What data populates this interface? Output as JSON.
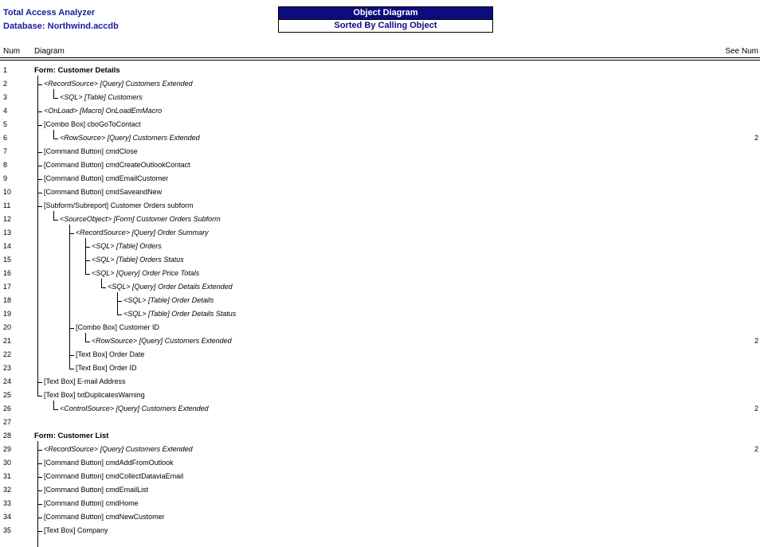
{
  "header": {
    "app_title": "Total Access Analyzer",
    "database": "Database: Northwind.accdb",
    "report_title": "Object Diagram",
    "report_subtitle": "Sorted By Calling Object"
  },
  "columns": {
    "num": "Num",
    "diagram": "Diagram",
    "see_num": "See Num"
  },
  "rows": [
    {
      "num": "1",
      "level": 0,
      "kind": "form",
      "prefix": "",
      "type": "",
      "name": "Form: Customer Details",
      "see": ""
    },
    {
      "num": "2",
      "level": 1,
      "kind": "ref",
      "prefix": "<RecordSource>",
      "type": "[Query]",
      "name": "Customers Extended",
      "see": ""
    },
    {
      "num": "3",
      "level": 2,
      "kind": "ref",
      "prefix": "<SQL>",
      "type": "[Table]",
      "name": "Customers",
      "see": "",
      "last": true
    },
    {
      "num": "4",
      "level": 1,
      "kind": "ref",
      "prefix": "<OnLoad>",
      "type": "[Macro]",
      "name": "OnLoadEmMacro",
      "see": ""
    },
    {
      "num": "5",
      "level": 1,
      "kind": "ctl",
      "prefix": "",
      "type": "[Combo Box]",
      "name": "cboGoToContact",
      "see": ""
    },
    {
      "num": "6",
      "level": 2,
      "kind": "ref",
      "prefix": "<RowSource>",
      "type": "[Query]",
      "name": "Customers Extended",
      "see": "2",
      "last": true
    },
    {
      "num": "7",
      "level": 1,
      "kind": "ctl",
      "prefix": "",
      "type": "[Command Button]",
      "name": "cmdClose",
      "see": ""
    },
    {
      "num": "8",
      "level": 1,
      "kind": "ctl",
      "prefix": "",
      "type": "[Command Button]",
      "name": "cmdCreateOutlookContact",
      "see": ""
    },
    {
      "num": "9",
      "level": 1,
      "kind": "ctl",
      "prefix": "",
      "type": "[Command Button]",
      "name": "cmdEmailCustomer",
      "see": ""
    },
    {
      "num": "10",
      "level": 1,
      "kind": "ctl",
      "prefix": "",
      "type": "[Command Button]",
      "name": "cmdSaveandNew",
      "see": ""
    },
    {
      "num": "11",
      "level": 1,
      "kind": "ctl",
      "prefix": "",
      "type": "[Subform/Subreport]",
      "name": "Customer Orders subform",
      "see": ""
    },
    {
      "num": "12",
      "level": 2,
      "kind": "ref",
      "prefix": "<SourceObject>",
      "type": "[Form]",
      "name": "Customer Orders Subform",
      "see": "",
      "last": true
    },
    {
      "num": "13",
      "level": 3,
      "kind": "ref",
      "prefix": "<RecordSource>",
      "type": "[Query]",
      "name": "Order Summary",
      "see": ""
    },
    {
      "num": "14",
      "level": 4,
      "kind": "ref",
      "prefix": "<SQL>",
      "type": "[Table]",
      "name": "Orders",
      "see": ""
    },
    {
      "num": "15",
      "level": 4,
      "kind": "ref",
      "prefix": "<SQL>",
      "type": "[Table]",
      "name": "Orders Status",
      "see": ""
    },
    {
      "num": "16",
      "level": 4,
      "kind": "ref",
      "prefix": "<SQL>",
      "type": "[Query]",
      "name": "Order Price Totals",
      "see": "",
      "last": true
    },
    {
      "num": "17",
      "level": 5,
      "kind": "ref",
      "prefix": "<SQL>",
      "type": "[Query]",
      "name": "Order Details Extended",
      "see": "",
      "last": true
    },
    {
      "num": "18",
      "level": 6,
      "kind": "ref",
      "prefix": "<SQL>",
      "type": "[Table]",
      "name": "Order Details",
      "see": ""
    },
    {
      "num": "19",
      "level": 6,
      "kind": "ref",
      "prefix": "<SQL>",
      "type": "[Table]",
      "name": "Order Details Status",
      "see": "",
      "last": true
    },
    {
      "num": "20",
      "level": 3,
      "kind": "ctl",
      "prefix": "",
      "type": "[Combo Box]",
      "name": "Customer ID",
      "see": ""
    },
    {
      "num": "21",
      "level": 4,
      "kind": "ref",
      "prefix": "<RowSource>",
      "type": "[Query]",
      "name": "Customers Extended",
      "see": "2",
      "last": true
    },
    {
      "num": "22",
      "level": 3,
      "kind": "ctl",
      "prefix": "",
      "type": "[Text Box]",
      "name": "Order Date",
      "see": ""
    },
    {
      "num": "23",
      "level": 3,
      "kind": "ctl",
      "prefix": "",
      "type": "[Text Box]",
      "name": "Order ID",
      "see": "",
      "last": true
    },
    {
      "num": "24",
      "level": 1,
      "kind": "ctl",
      "prefix": "",
      "type": "[Text Box]",
      "name": "E-mail Address",
      "see": ""
    },
    {
      "num": "25",
      "level": 1,
      "kind": "ctl",
      "prefix": "",
      "type": "[Text Box]",
      "name": "txtDuplicatesWarning",
      "see": "",
      "last": true
    },
    {
      "num": "26",
      "level": 2,
      "kind": "ref",
      "prefix": "<ControlSource>",
      "type": "[Query]",
      "name": "Customers Extended",
      "see": "2",
      "last": true
    },
    {
      "num": "27",
      "level": 0,
      "kind": "blank",
      "prefix": "",
      "type": "",
      "name": "",
      "see": ""
    },
    {
      "num": "28",
      "level": 0,
      "kind": "form",
      "prefix": "",
      "type": "",
      "name": "Form: Customer List",
      "see": ""
    },
    {
      "num": "29",
      "level": 1,
      "kind": "ref",
      "prefix": "<RecordSource>",
      "type": "[Query]",
      "name": "Customers Extended",
      "see": "2"
    },
    {
      "num": "30",
      "level": 1,
      "kind": "ctl",
      "prefix": "",
      "type": "[Command Button]",
      "name": "cmdAddFromOutlook",
      "see": ""
    },
    {
      "num": "31",
      "level": 1,
      "kind": "ctl",
      "prefix": "",
      "type": "[Command Button]",
      "name": "cmdCollectDataviaEmail",
      "see": ""
    },
    {
      "num": "32",
      "level": 1,
      "kind": "ctl",
      "prefix": "",
      "type": "[Command Button]",
      "name": "cmdEmailList",
      "see": ""
    },
    {
      "num": "33",
      "level": 1,
      "kind": "ctl",
      "prefix": "",
      "type": "[Command Button]",
      "name": "cmdHome",
      "see": ""
    },
    {
      "num": "34",
      "level": 1,
      "kind": "ctl",
      "prefix": "",
      "type": "[Command Button]",
      "name": "cmdNewCustomer",
      "see": ""
    },
    {
      "num": "35",
      "level": 1,
      "kind": "ctl",
      "prefix": "",
      "type": "[Text Box]",
      "name": "Company",
      "see": ""
    }
  ]
}
